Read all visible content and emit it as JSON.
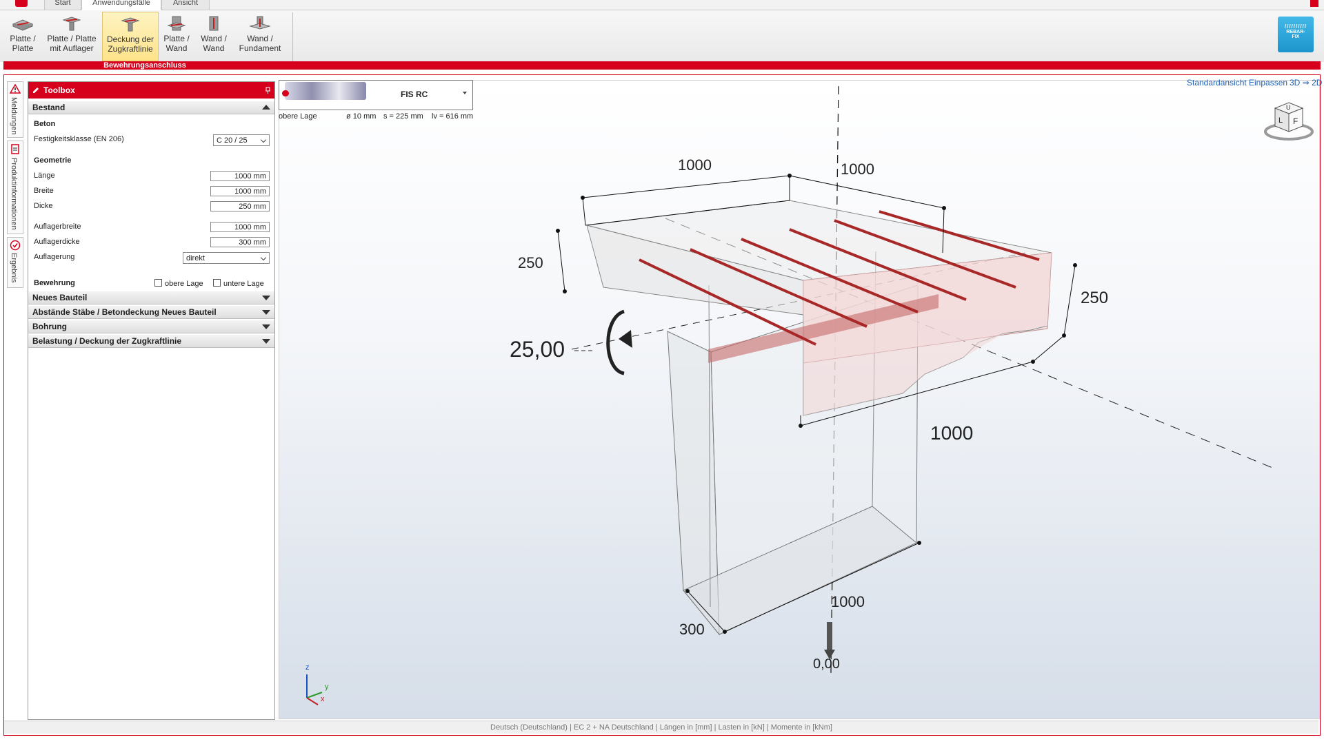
{
  "tabs": [
    {
      "label": "Start",
      "active": false
    },
    {
      "label": "Anwendungsfälle",
      "active": true
    },
    {
      "label": "Ansicht",
      "active": false
    }
  ],
  "ribbon": {
    "buttons": [
      {
        "line1": "Platte /",
        "line2": "Platte"
      },
      {
        "line1": "Platte / Platte",
        "line2": "mit Auflager"
      },
      {
        "line1": "Deckung der",
        "line2": "Zugkraftlinie"
      },
      {
        "line1": "Platte /",
        "line2": "Wand"
      },
      {
        "line1": "Wand /",
        "line2": "Wand"
      },
      {
        "line1": "Wand /",
        "line2": "Fundament"
      }
    ],
    "group_label": "Bewehrungsanschluss",
    "rebar_line1": "REBAR-",
    "rebar_line2": "FIX"
  },
  "side_tabs": [
    "Meldungen",
    "Produktinformationen",
    "Ergebnis"
  ],
  "toolbox": {
    "title": "Toolbox",
    "bestand": "Bestand",
    "beton": "Beton",
    "festigkeit_label": "Festigkeitsklasse (EN 206)",
    "festigkeit_value": "C 20 / 25",
    "geometrie": "Geometrie",
    "laenge_label": "Länge",
    "laenge_value": "1000 mm",
    "breite_label": "Breite",
    "breite_value": "1000 mm",
    "dicke_label": "Dicke",
    "dicke_value": "250 mm",
    "auflagerbreite_label": "Auflagerbreite",
    "auflagerbreite_value": "1000 mm",
    "auflagerdicke_label": "Auflagerdicke",
    "auflagerdicke_value": "300 mm",
    "auflagerung_label": "Auflagerung",
    "auflagerung_value": "direkt",
    "bewehrung": "Bewehrung",
    "obere_lage": "obere Lage",
    "untere_lage": "untere Lage",
    "sections": [
      "Neues Bauteil",
      "Abstände Stäbe / Betondeckung Neues Bauteil",
      "Bohrung",
      "Belastung / Deckung der Zugkraftlinie"
    ]
  },
  "product": {
    "name": "FIS RC",
    "lage": "obere Lage",
    "diameter": "ø 10 mm",
    "spacing": "s = 225 mm",
    "lv": "lv = 616 mm"
  },
  "view_links": {
    "standard": "Standardansicht",
    "fit": "Einpassen",
    "mode": "3D ⇒ 2D"
  },
  "cube": {
    "top": "U",
    "left": "L",
    "front": "F"
  },
  "dimensions": {
    "top_length": "1000",
    "top_width": "1000",
    "left_thickness": "250",
    "right_thickness": "250",
    "front_length": "1000",
    "support_width": "1000",
    "support_thickness": "300",
    "moment": "25,00",
    "load": "0,00"
  },
  "axes": {
    "z": "z",
    "y": "y",
    "x": "x"
  },
  "status": "Deutsch (Deutschland) | EC 2 + NA Deutschland | Längen in [mm] | Lasten in [kN] | Momente in [kNm]",
  "colors": {
    "accent": "#d6001c",
    "rebar": "#b03030",
    "link": "#1f5fb4"
  }
}
